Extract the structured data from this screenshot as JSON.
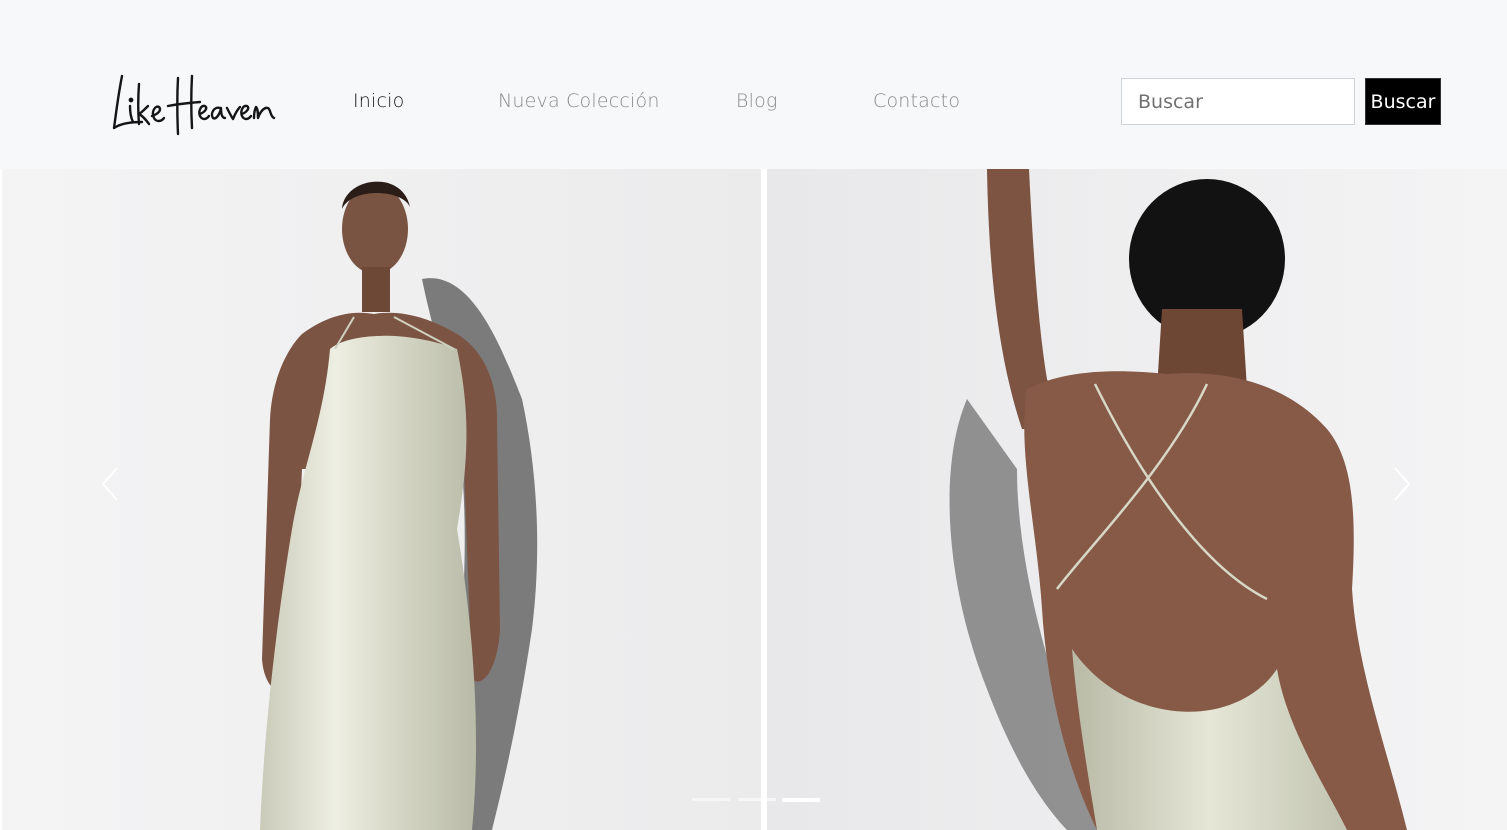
{
  "brand": {
    "logo_text": "Like Heaven"
  },
  "nav": {
    "items": [
      {
        "label": "Inicio",
        "active": true
      },
      {
        "label": "Nueva Colección",
        "active": false
      },
      {
        "label": "Blog",
        "active": false
      },
      {
        "label": "Contacto",
        "active": false
      }
    ]
  },
  "search": {
    "placeholder": "Buscar",
    "value": "",
    "button_label": "Buscar"
  },
  "carousel": {
    "slides_count": 3,
    "active_index": 2,
    "prev_icon": "chevron-left-icon",
    "next_icon": "chevron-right-icon",
    "photos": [
      {
        "subject": "model-front-satin-halter-dress"
      },
      {
        "subject": "model-back-satin-cross-strap-dress"
      }
    ]
  },
  "colors": {
    "nav_background": "#f7f8fa",
    "active_link": "#1a1a1a",
    "inactive_link": "#8a8a8a",
    "button_background": "#000000",
    "button_text": "#ffffff",
    "dress": "#d9dac9"
  }
}
